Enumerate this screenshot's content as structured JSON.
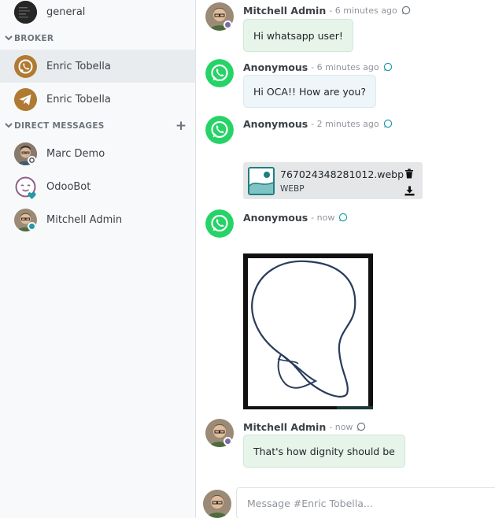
{
  "sidebar": {
    "channel_general": "general",
    "category_broker": "BROKER",
    "broker_items": [
      {
        "label": "Enric Tobella",
        "icon": "whatsapp-icon"
      },
      {
        "label": "Enric Tobella",
        "icon": "telegram-icon"
      }
    ],
    "category_dm": "DIRECT MESSAGES",
    "add_symbol": "+",
    "dm_items": [
      {
        "label": "Marc Demo"
      },
      {
        "label": "OdooBot"
      },
      {
        "label": "Mitchell Admin"
      }
    ]
  },
  "messages": [
    {
      "author": "Mitchell Admin",
      "time": "- 6 minutes ago",
      "text": "Hi whatsapp user!"
    },
    {
      "author": "Anonymous",
      "time": "- 6 minutes ago",
      "text": "Hi OCA!! How are you?"
    },
    {
      "author": "Anonymous",
      "time": "- 2 minutes ago",
      "attachment": {
        "filename": "767024348281012.webp",
        "type": "WEBP"
      }
    },
    {
      "author": "Anonymous",
      "time": "- now"
    },
    {
      "author": "Mitchell Admin",
      "time": "- now",
      "text": "That's how dignity should be"
    }
  ],
  "composer": {
    "placeholder": "Message #Enric Tobella..."
  },
  "colors": {
    "whatsapp": "#25d366",
    "telegram": "#b07a33",
    "accent": "#1f7f80",
    "online": "#1f9bab",
    "away": "#7a6ba8"
  }
}
